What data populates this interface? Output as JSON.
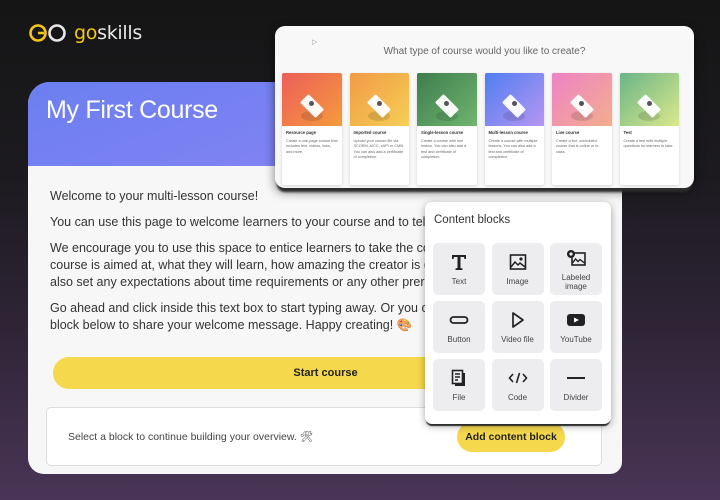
{
  "brand": {
    "go": "go",
    "skills": "skills",
    "gold": "#f5c518"
  },
  "course": {
    "title": "My First Course",
    "paragraphs": [
      "Welcome to your multi-lesson course!",
      "You can use this page to welcome learners to your course and to tell them a bit",
      "We encourage you to use this space to entice learners to take the course – for e",
      "course is aimed at, what they will learn, how amazing the creator is (that's you!)",
      "also set any expectations about time requirements or any other prerequisites.",
      "Go ahead and click inside this text box to start typing away. Or you can delete th",
      "block below to share your welcome message. Happy creating! 🎨"
    ],
    "start_button": "Start course",
    "block_prompt": "Select a block to continue building your overview. 🛠",
    "add_block_button": "Add content block",
    "header_gradient": [
      "#6b7ff0",
      "#8f86f3"
    ],
    "button_color": "#f6d84c"
  },
  "course_types": {
    "title": "What type of course would you like to create?",
    "cards": [
      {
        "name": "Resource page",
        "desc": "Create a one-page course that includes text, videos, links, and more.",
        "colors": [
          "#ec5e5a",
          "#f59a3c"
        ]
      },
      {
        "name": "Imported course",
        "desc": "Upload your course file via SCORM, AICC, xAPI or CMI5. You can also add a certificate of completion.",
        "colors": [
          "#f19a45",
          "#f5cf55"
        ]
      },
      {
        "name": "Single-lesson course",
        "desc": "Create a course with one lesson. You can also add a test and certificate of completion.",
        "colors": [
          "#3e7d4e",
          "#6fb56e"
        ]
      },
      {
        "name": "Multi-lesson course",
        "desc": "Create a course with multiple lessons. You can also add a test and certificate of completion.",
        "colors": [
          "#4f7ef0",
          "#b796f3"
        ]
      },
      {
        "name": "Live course",
        "desc": "Create a live, scheduled course that is online or in-class.",
        "colors": [
          "#ee82c6",
          "#f3ae8d"
        ]
      },
      {
        "name": "Test",
        "desc": "Create a test with multiple questions for learners to take.",
        "colors": [
          "#6ab586",
          "#dbe88c"
        ]
      }
    ]
  },
  "content_blocks": {
    "title": "Content blocks",
    "items": [
      {
        "label": "Text",
        "icon": "text-icon"
      },
      {
        "label": "Image",
        "icon": "image-icon"
      },
      {
        "label": "Labeled image",
        "icon": "labeled-image-icon"
      },
      {
        "label": "Button",
        "icon": "button-icon"
      },
      {
        "label": "Video file",
        "icon": "video-file-icon"
      },
      {
        "label": "YouTube",
        "icon": "youtube-icon"
      },
      {
        "label": "File",
        "icon": "file-icon"
      },
      {
        "label": "Code",
        "icon": "code-icon"
      },
      {
        "label": "Divider",
        "icon": "divider-icon"
      }
    ]
  }
}
